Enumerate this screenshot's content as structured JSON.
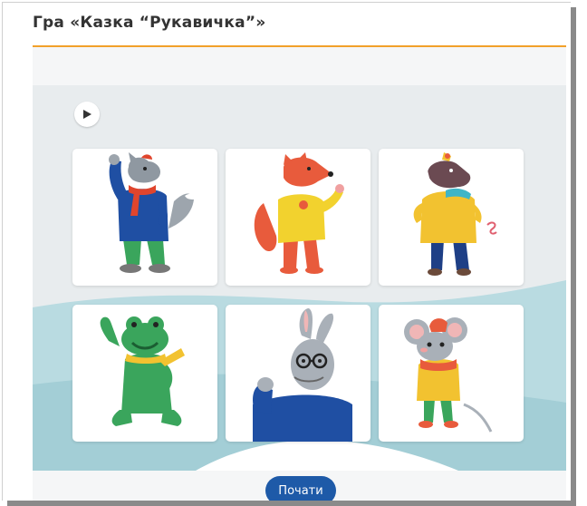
{
  "page": {
    "title": "Гра «Казка “Рукавичка”»",
    "accent_color": "#f2a12a",
    "button_color": "#1e5aa8"
  },
  "controls": {
    "play_icon": "play-icon",
    "start_label": "Почати"
  },
  "cards": [
    {
      "character": "wolf"
    },
    {
      "character": "fox"
    },
    {
      "character": "boar"
    },
    {
      "character": "frog"
    },
    {
      "character": "hare"
    },
    {
      "character": "mouse"
    }
  ]
}
